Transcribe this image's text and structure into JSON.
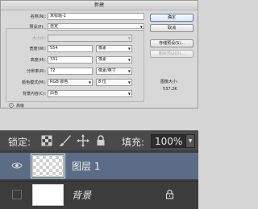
{
  "dialog": {
    "title": "新建",
    "name": {
      "label": "名称(N):",
      "value": "未标题-1"
    },
    "preset": {
      "label": "预设(P):",
      "value": "自定"
    },
    "size": {
      "label": "大小(I):",
      "value": ""
    },
    "width": {
      "label": "宽度(W):",
      "value": "554",
      "unit": "像素"
    },
    "height": {
      "label": "高度(H):",
      "value": "331",
      "unit": "像素"
    },
    "resolution": {
      "label": "分辨率(R):",
      "value": "72",
      "unit": "像素/英寸"
    },
    "color_mode": {
      "label": "颜色模式(M):",
      "value": "RGB 颜色",
      "depth": "8 位"
    },
    "background": {
      "label": "背景内容(C):",
      "value": "白色"
    },
    "advanced": {
      "label": "高级"
    },
    "buttons": {
      "ok": "确定",
      "cancel": "取消",
      "save_preset": "存储预设(S)...",
      "delete_preset": "删除预设(D)..."
    },
    "image_size": {
      "label": "图像大小:",
      "value": "537.2K"
    }
  },
  "layers": {
    "lock_label": "锁定:",
    "fill_label": "填充:",
    "fill_value": "100%",
    "items": [
      {
        "name": "图层 1",
        "selected": true,
        "visible": true
      },
      {
        "name": "背景",
        "selected": false,
        "visible": false,
        "locked": true
      }
    ]
  }
}
